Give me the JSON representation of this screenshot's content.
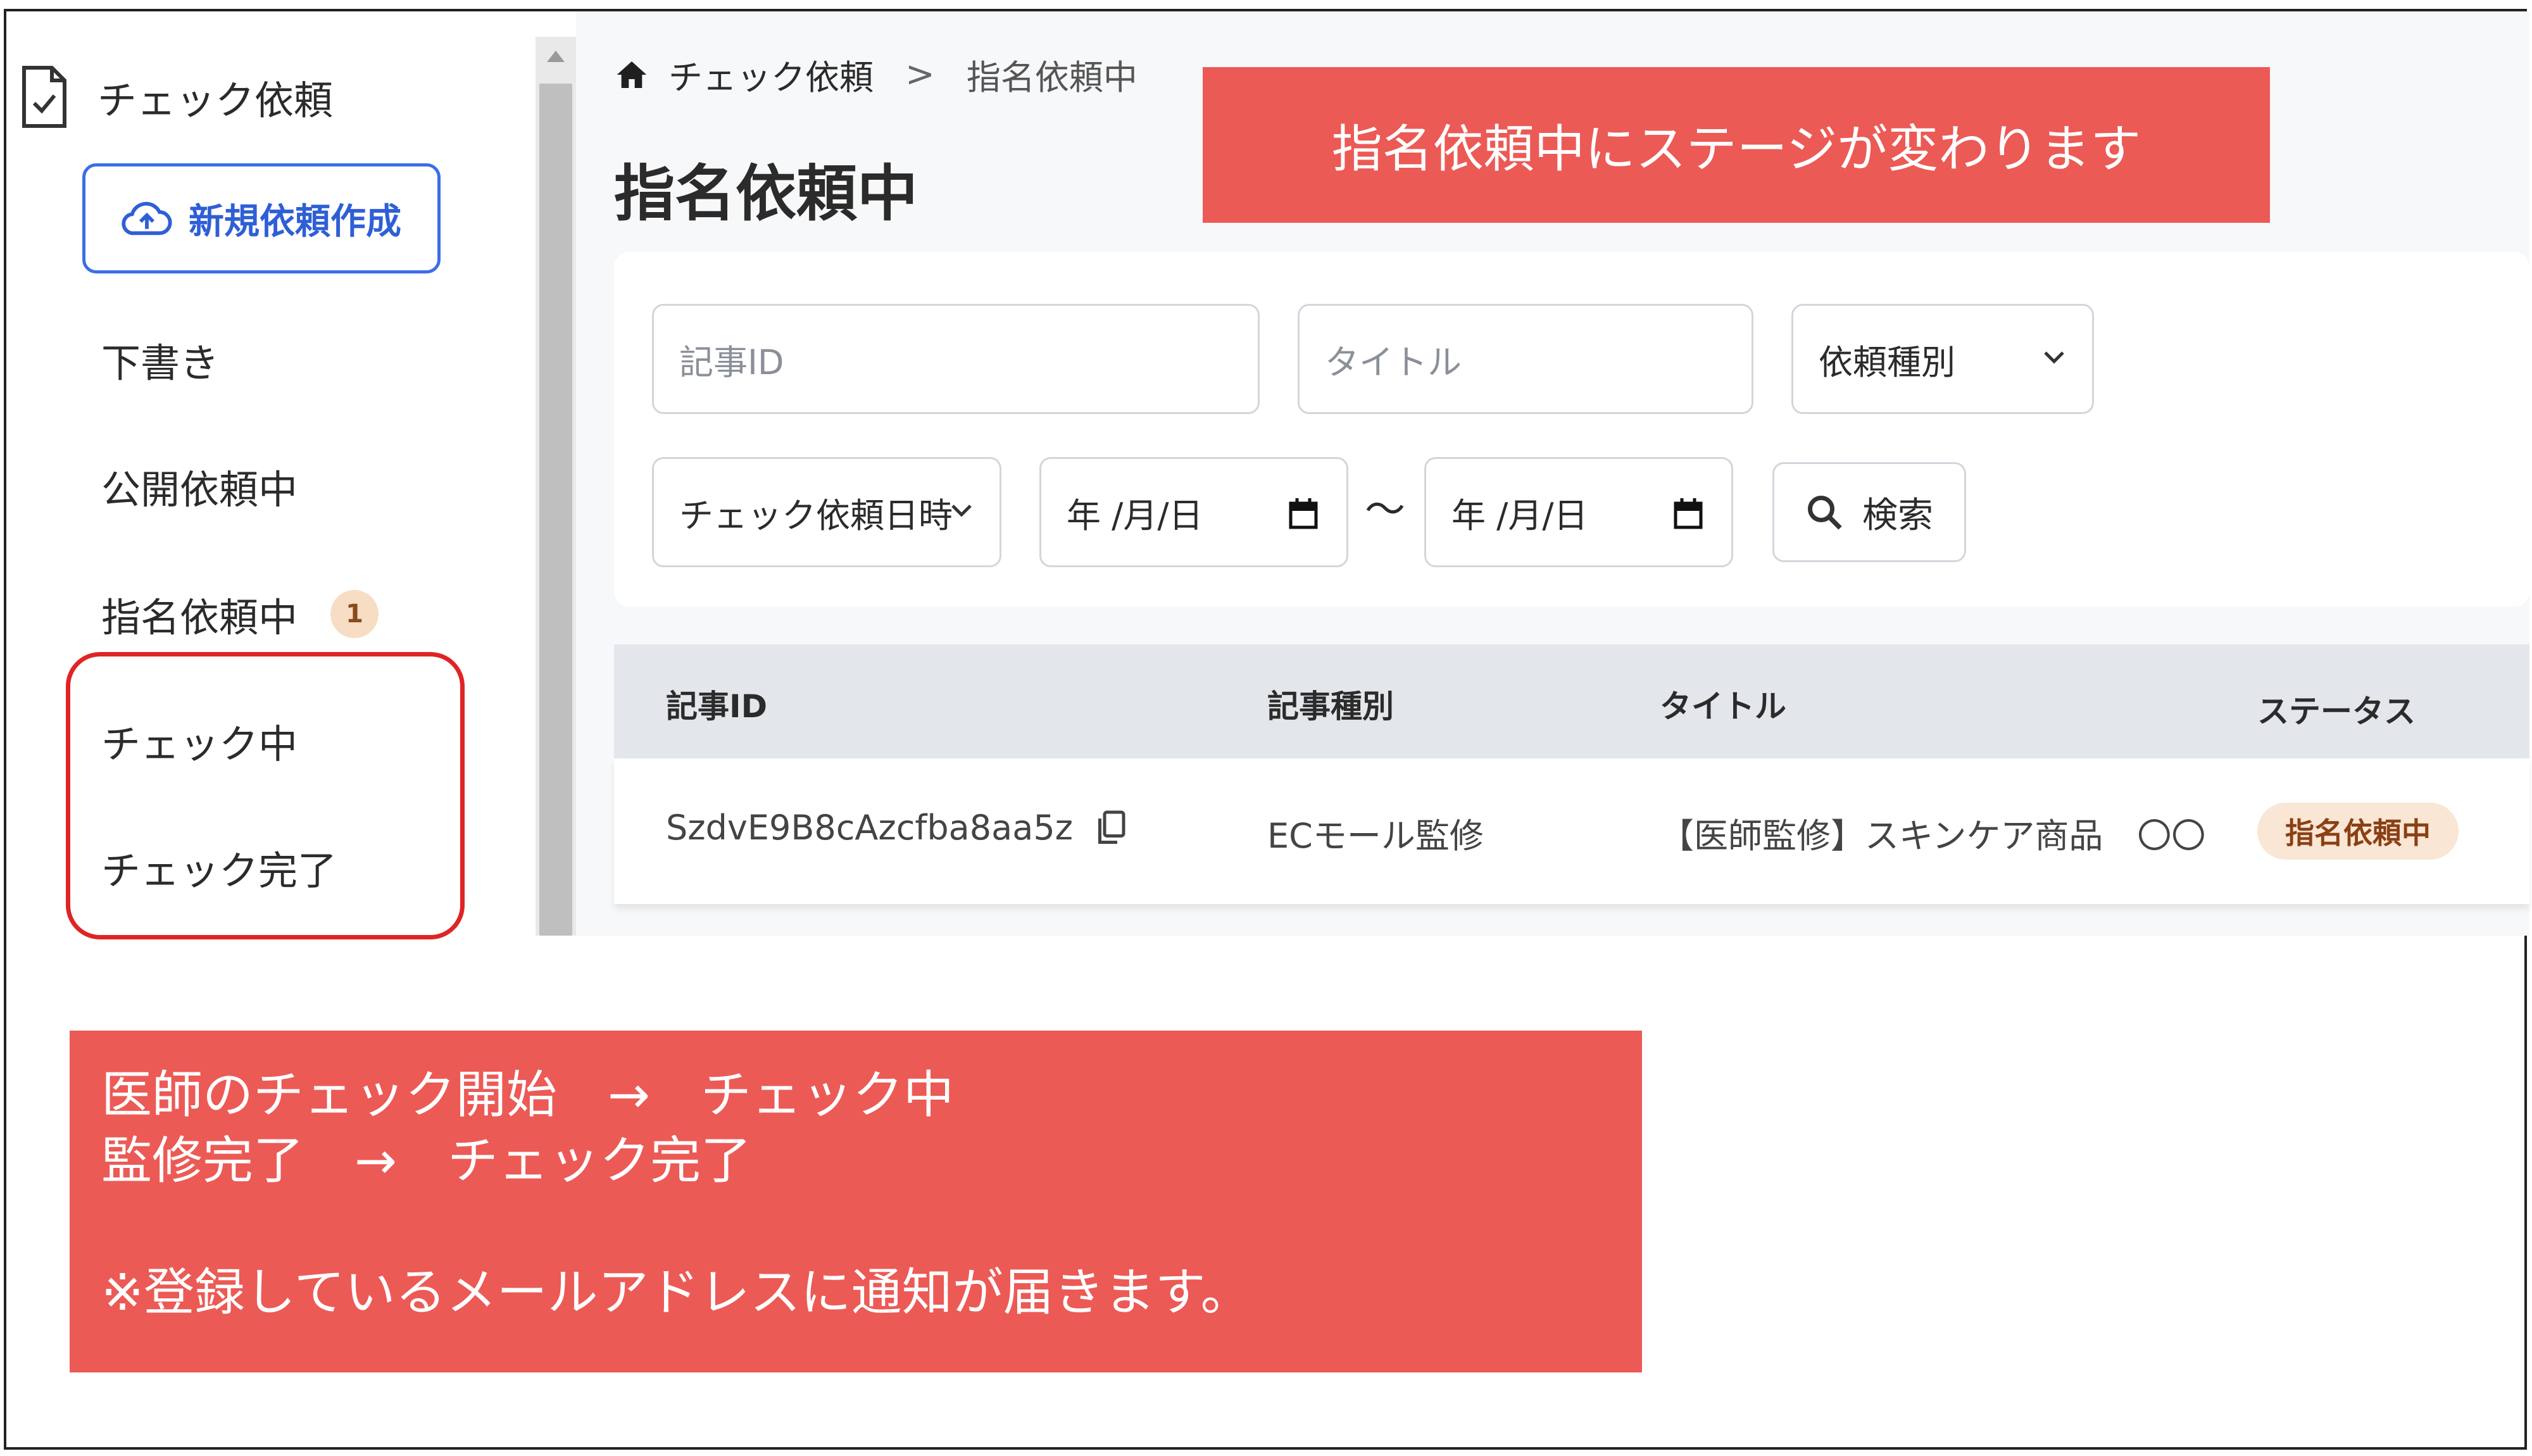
{
  "sidebar": {
    "header_label": "チェック依頼",
    "new_request_label": "新規依頼作成",
    "items": [
      {
        "label": "下書き"
      },
      {
        "label": "公開依頼中"
      },
      {
        "label": "指名依頼中",
        "badge": "1"
      },
      {
        "label": "チェック中"
      },
      {
        "label": "チェック完了"
      }
    ]
  },
  "breadcrumb": {
    "parent": "チェック依頼",
    "separator": ">",
    "current": "指名依頼中"
  },
  "page_title": "指名依頼中",
  "filters": {
    "article_id_placeholder": "記事ID",
    "title_placeholder": "タイトル",
    "request_type_label": "依頼種別",
    "date_type_label": "チェック依頼日時",
    "date_from": "年 /月/日",
    "date_range_sep": "〜",
    "date_to": "年 /月/日",
    "search_label": "検索"
  },
  "table": {
    "headers": [
      "記事ID",
      "記事種別",
      "タイトル",
      "ステータス"
    ],
    "rows": [
      {
        "article_id": "SzdvE9B8cAzcfba8aa5z",
        "article_type": "ECモール監修",
        "title": "【医師監修】スキンケア商品　〇〇",
        "status": "指名依頼中"
      }
    ]
  },
  "annotations": {
    "top": "指名依頼中にステージが変わります",
    "bottom": {
      "line1": "医師のチェック開始　→　チェック中",
      "line2": "監修完了　→　チェック完了",
      "line3": "※登録しているメールアドレスに通知が届きます。"
    }
  },
  "colors": {
    "accent_blue": "#3a6ee8",
    "highlight_red": "#e02424",
    "callout_red": "#ec5a56",
    "status_bg": "#f9e6d4"
  }
}
